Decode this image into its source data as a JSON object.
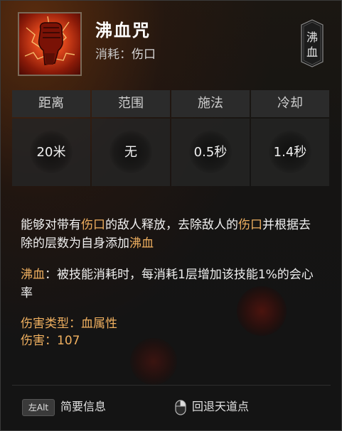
{
  "skill": {
    "name": "沸血咒",
    "cost_label": "消耗：",
    "cost_value": "伤口",
    "badge_line1": "沸",
    "badge_line2": "血",
    "icon": "burning-fist-icon"
  },
  "stats": [
    {
      "label": "距离",
      "value": "20米"
    },
    {
      "label": "范围",
      "value": "无"
    },
    {
      "label": "施法",
      "value": "0.5秒"
    },
    {
      "label": "冷却",
      "value": "1.4秒"
    }
  ],
  "description": {
    "p1_a": "能够对带有",
    "p1_hl1": "伤口",
    "p1_b": "的敌人释放，去除敌人的",
    "p1_hl2": "伤口",
    "p1_c": "并根据去除的层数为自身添加",
    "p1_hl3": "沸血",
    "p2_hl": "沸血",
    "p2_text": "：被技能消耗时，每消耗1层增加该技能1%的会心率",
    "dmg_type_label": "伤害类型：",
    "dmg_type_value": "血属性",
    "dmg_label": "伤害：",
    "dmg_value": "107"
  },
  "footer": {
    "key_label": "左Alt",
    "brief_info": "简要信息",
    "mouse_icon": "mouse-icon",
    "back_label": "回退天道点"
  },
  "colors": {
    "highlight": "#f0b060",
    "panel_bg": "#151413"
  }
}
